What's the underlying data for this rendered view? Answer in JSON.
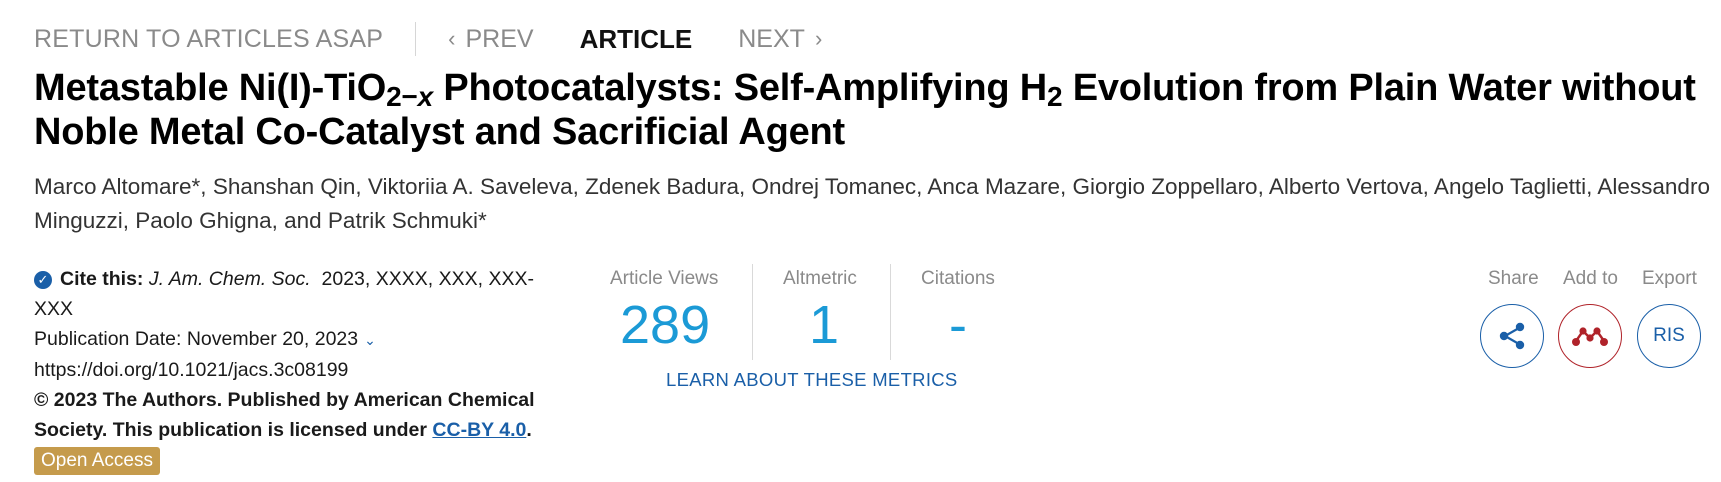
{
  "nav": {
    "return_label": "RETURN TO ARTICLES ASAP",
    "prev_label": "PREV",
    "article_label": "ARTICLE",
    "next_label": "NEXT"
  },
  "title": {
    "part1": "Metastable Ni(I)-TiO",
    "sub1": "2−",
    "sub1_var": "x",
    "part2": " Photocatalysts: Self-Amplifying H",
    "sub2": "2",
    "part3": " Evolution from Plain Water without Noble Metal Co-Catalyst and Sacrificial Agent"
  },
  "authors": "Marco Altomare*, Shanshan Qin, Viktoriia A. Saveleva, Zdenek Badura, Ondrej Tomanec, Anca Mazare, Giorgio Zoppellaro, Alberto Vertova, Angelo Taglietti, Alessandro Minguzzi, Paolo Ghigna, and Patrik Schmuki*",
  "cite": {
    "label": "Cite this:",
    "journal": "J. Am. Chem. Soc.",
    "ref": "2023, XXXX, XXX, XXX-XXX",
    "pub_date": "Publication Date: November 20, 2023",
    "doi": "https://doi.org/10.1021/jacs.3c08199",
    "copyright": "© 2023 The Authors. Published by American Chemical Society. This publication is licensed under",
    "license": "CC-BY 4.0",
    "license_end": ".",
    "open_access": "Open Access"
  },
  "metrics": {
    "views_label": "Article Views",
    "views_value": "289",
    "altmetric_label": "Altmetric",
    "altmetric_value": "1",
    "citations_label": "Citations",
    "citations_value": "-",
    "learn_label": "LEARN ABOUT THESE METRICS"
  },
  "actions": {
    "share_label": "Share",
    "addto_label": "Add to",
    "export_label": "Export",
    "ris_label": "RIS",
    "share_icon": "share-icon",
    "addto_icon": "mendeley-icon"
  },
  "colors": {
    "accent_blue": "#1a5fa8",
    "metric_blue": "#1b9ad6",
    "open_access_gold": "#c59b4c",
    "mendeley_red": "#b0232a"
  }
}
